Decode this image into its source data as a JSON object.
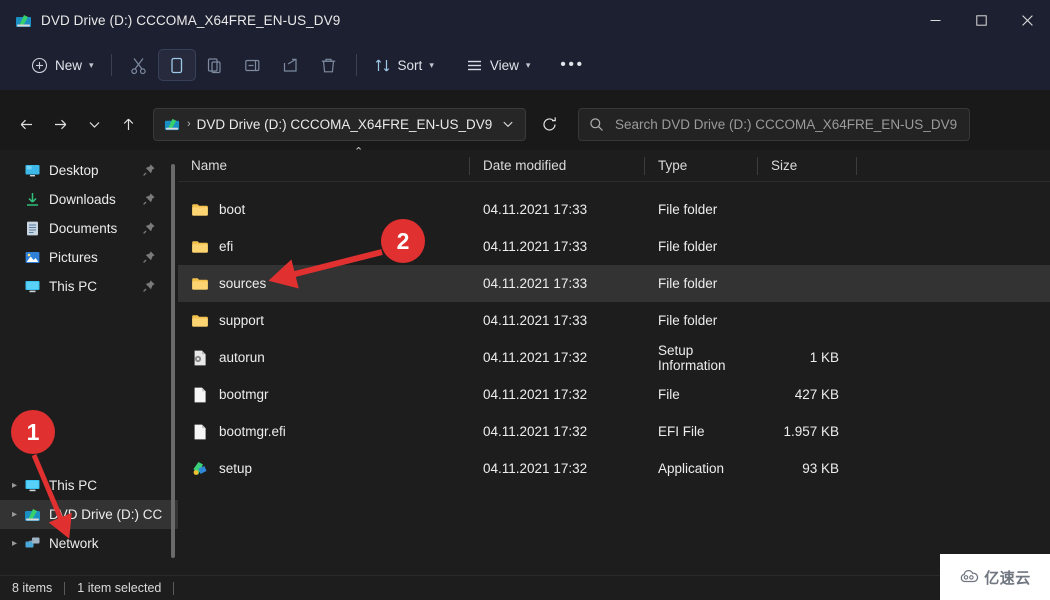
{
  "window": {
    "title": "DVD Drive (D:) CCCOMA_X64FRE_EN-US_DV9",
    "title_icon": "dvd-drive-icon",
    "controls": {
      "minimize": "—",
      "maximize": "□",
      "close": "✕"
    }
  },
  "toolbar": {
    "new_label": "New",
    "sort_label": "Sort",
    "view_label": "View",
    "overflow_label": "•••",
    "icons": [
      "new-icon",
      "cut-icon",
      "copy-icon",
      "paste-icon",
      "rename-icon",
      "share-icon",
      "delete-icon",
      "sort-icon",
      "view-icon",
      "more-icon"
    ]
  },
  "nav": {
    "back": "←",
    "forward": "→",
    "recent": "⌄",
    "up": "↑",
    "refresh": "⟳",
    "address_dropdown": "⌄"
  },
  "address": {
    "icon": "dvd-drive-icon",
    "separator": "›",
    "path": "DVD Drive (D:) CCCOMA_X64FRE_EN-US_DV9"
  },
  "search": {
    "icon": "search-icon",
    "placeholder": "Search DVD Drive (D:) CCCOMA_X64FRE_EN-US_DV9",
    "value": ""
  },
  "sidebar": {
    "quick_access": [
      {
        "label": "Desktop",
        "icon": "desktop-icon",
        "pinned": true
      },
      {
        "label": "Downloads",
        "icon": "downloads-icon",
        "pinned": true
      },
      {
        "label": "Documents",
        "icon": "documents-icon",
        "pinned": true
      },
      {
        "label": "Pictures",
        "icon": "pictures-icon",
        "pinned": true
      },
      {
        "label": "This PC",
        "icon": "this-pc-icon",
        "pinned": true
      }
    ],
    "tree": [
      {
        "label": "This PC",
        "icon": "this-pc-icon",
        "selected": false,
        "expander": "›"
      },
      {
        "label": "DVD Drive (D:) CC",
        "icon": "dvd-drive-icon",
        "selected": true,
        "expander": "›"
      },
      {
        "label": "Network",
        "icon": "network-icon",
        "selected": false,
        "expander": "›"
      }
    ]
  },
  "columns": {
    "name": "Name",
    "date_modified": "Date modified",
    "type": "Type",
    "size": "Size",
    "sort_indicator": "⌃"
  },
  "files": [
    {
      "name": "boot",
      "icon": "folder-icon",
      "date": "04.11.2021 17:33",
      "type": "File folder",
      "size": "",
      "selected": false
    },
    {
      "name": "efi",
      "icon": "folder-icon",
      "date": "04.11.2021 17:33",
      "type": "File folder",
      "size": "",
      "selected": false
    },
    {
      "name": "sources",
      "icon": "folder-icon",
      "date": "04.11.2021 17:33",
      "type": "File folder",
      "size": "",
      "selected": true
    },
    {
      "name": "support",
      "icon": "folder-icon",
      "date": "04.11.2021 17:33",
      "type": "File folder",
      "size": "",
      "selected": false
    },
    {
      "name": "autorun",
      "icon": "setup-info-icon",
      "date": "04.11.2021 17:32",
      "type": "Setup Information",
      "size": "1 KB",
      "selected": false
    },
    {
      "name": "bootmgr",
      "icon": "file-icon",
      "date": "04.11.2021 17:32",
      "type": "File",
      "size": "427 KB",
      "selected": false
    },
    {
      "name": "bootmgr.efi",
      "icon": "file-icon",
      "date": "04.11.2021 17:32",
      "type": "EFI File",
      "size": "1.957 KB",
      "selected": false
    },
    {
      "name": "setup",
      "icon": "application-icon",
      "date": "04.11.2021 17:32",
      "type": "Application",
      "size": "93 KB",
      "selected": false
    }
  ],
  "status": {
    "item_count": "8 items",
    "selection": "1 item selected"
  },
  "annotations": [
    {
      "label": "1",
      "color": "#e03030"
    },
    {
      "label": "2",
      "color": "#e03030"
    }
  ],
  "watermark": {
    "text": "亿速云",
    "icon": "cloud-icon"
  }
}
